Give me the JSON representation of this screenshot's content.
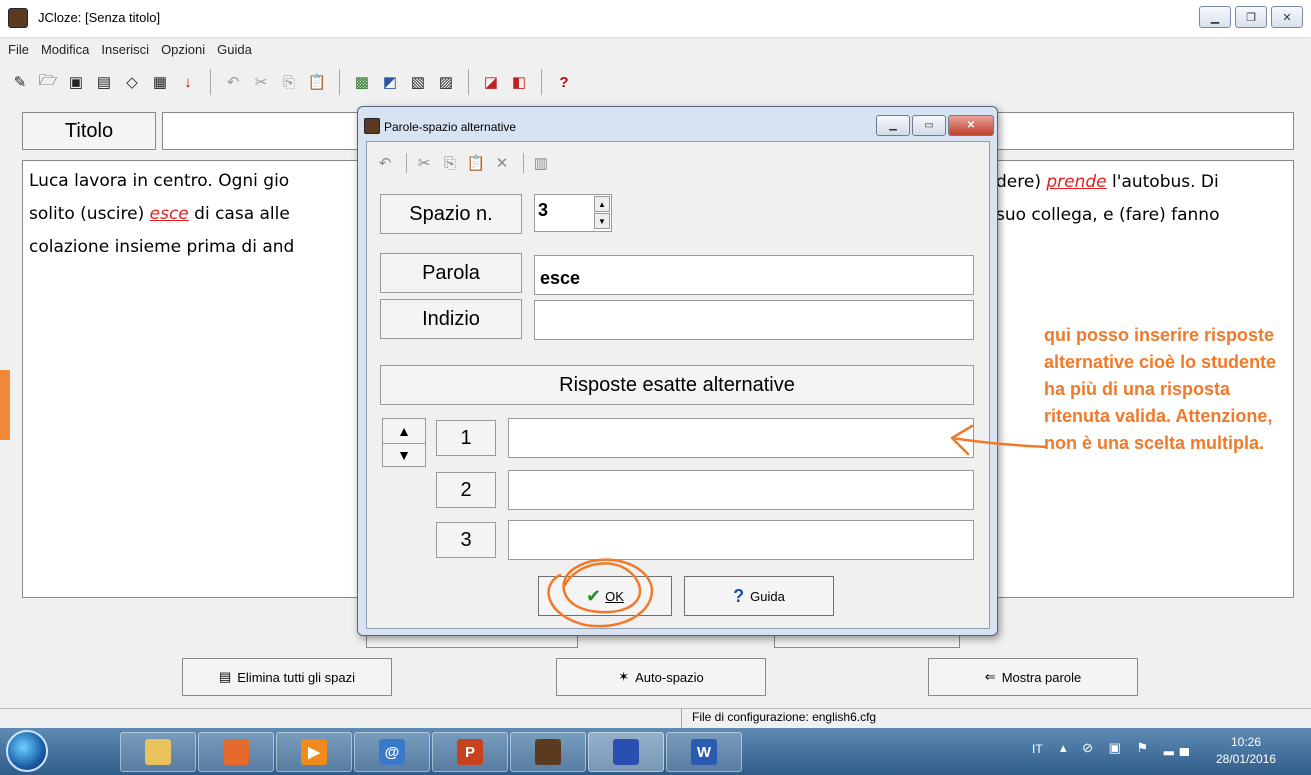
{
  "window": {
    "title": "JCloze: [Senza titolo]"
  },
  "menu": [
    "File",
    "Modifica",
    "Inserisci",
    "Opzioni",
    "Guida"
  ],
  "main": {
    "titolo_label": "Titolo",
    "text": {
      "line1_a": "Luca lavora in centro. Ogni gio",
      "line1_b": "dere) ",
      "line1_gap": "prende",
      "line1_c": " l'autobus. Di",
      "line2_a": "solito (uscire) ",
      "line2_gap": "esce",
      "line2_b": " di casa alle",
      "line2_c": "suo collega, e (fare) fanno",
      "line3": "colazione insieme prima di and"
    },
    "buttons": {
      "elimina": "Elimina tutti gli spazi",
      "auto": "Auto-spazio",
      "mostra": "Mostra parole"
    }
  },
  "statusbar": {
    "config": "File di configurazione: english6.cfg"
  },
  "dialog": {
    "title": "Parole-spazio alternative",
    "spazio_label": "Spazio n.",
    "spazio_value": "3",
    "parola_label": "Parola",
    "parola_value": "esce",
    "indizio_label": "Indizio",
    "indizio_value": "",
    "risposte_header": "Risposte esatte alternative",
    "rows": [
      "1",
      "2",
      "3"
    ],
    "ok_label": "OK",
    "guida_label": "Guida"
  },
  "annotation": "qui posso inserire risposte alternative cioè lo studente ha più di una risposta ritenuta valida. Attenzione, non è una scelta multipla.",
  "taskbar": {
    "lang": "IT",
    "time": "10:26",
    "date": "28/01/2016"
  },
  "colors": {
    "annotation": "#f07a2a",
    "gap_word": "#e02020"
  }
}
